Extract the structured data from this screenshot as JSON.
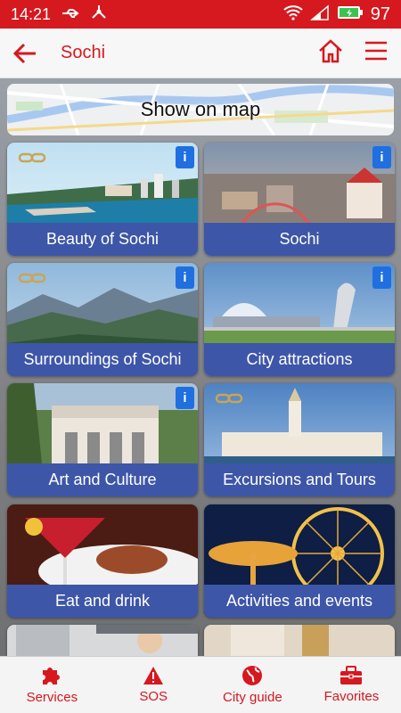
{
  "status_bar": {
    "time": "14:21",
    "battery": "97"
  },
  "app_bar": {
    "title": "Sochi"
  },
  "map_banner": {
    "label": "Show on map"
  },
  "tiles": [
    {
      "label": "Beauty of Sochi",
      "has_info": true,
      "has_link": true
    },
    {
      "label": "Sochi",
      "has_info": true,
      "has_link": false
    },
    {
      "label": "Surroundings of Sochi",
      "has_info": true,
      "has_link": true
    },
    {
      "label": "City attractions",
      "has_info": true,
      "has_link": false
    },
    {
      "label": "Art and Culture",
      "has_info": true,
      "has_link": false
    },
    {
      "label": "Excursions and Tours",
      "has_info": false,
      "has_link": true
    },
    {
      "label": "Eat and drink",
      "has_info": false,
      "has_link": false
    },
    {
      "label": "Activities and events",
      "has_info": false,
      "has_link": false
    }
  ],
  "bottom_nav": [
    {
      "label": "Services",
      "icon": "puzzle-icon"
    },
    {
      "label": "SOS",
      "icon": "warning-icon"
    },
    {
      "label": "City guide",
      "icon": "globe-icon"
    },
    {
      "label": "Favorites",
      "icon": "briefcase-icon"
    }
  ],
  "colors": {
    "accent": "#d6181f",
    "tile_label_bg": "#3d56a8",
    "info_badge": "#1f6fe0"
  }
}
